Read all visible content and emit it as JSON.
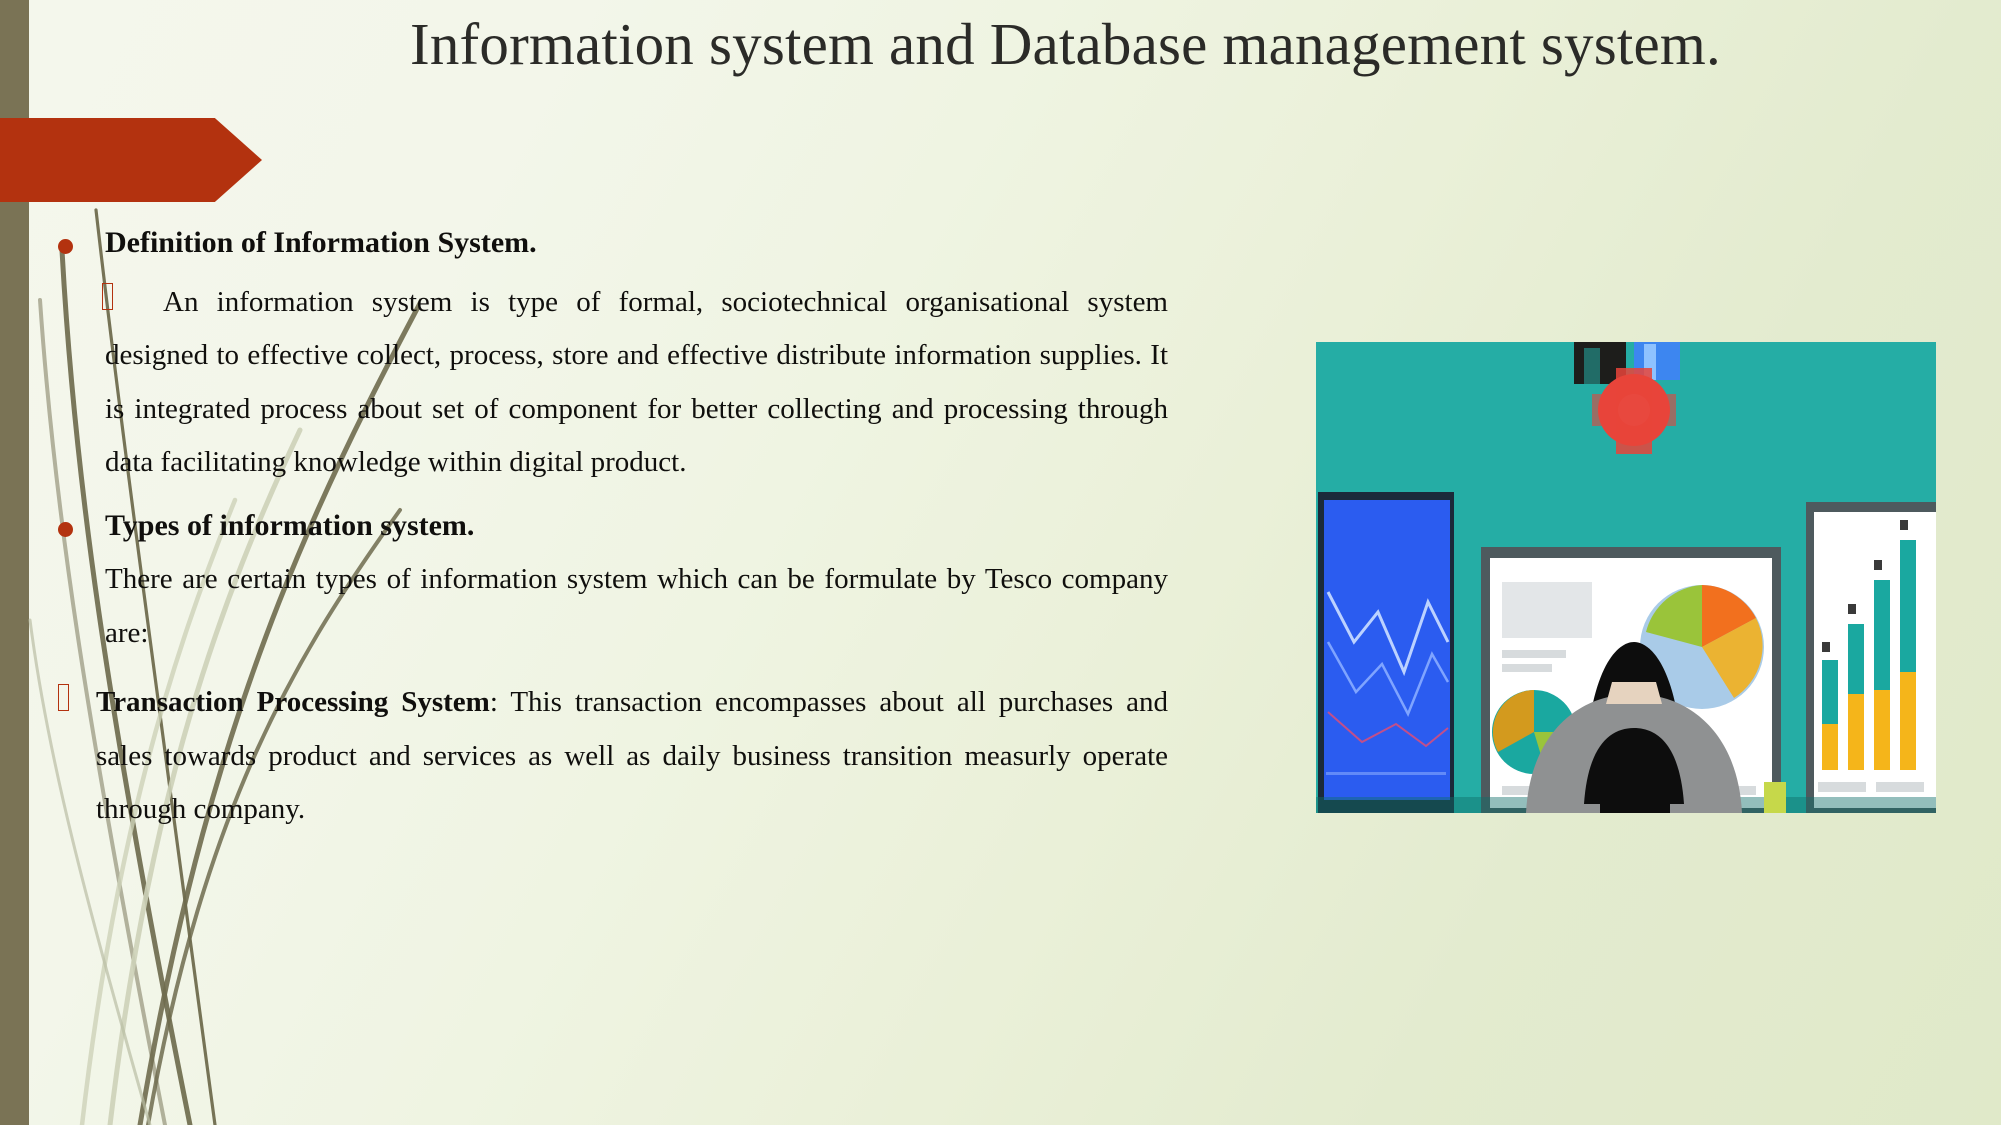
{
  "slide": {
    "title": "Information system and Database management system.",
    "background_color": "#eaf0da",
    "accent_color": "#b3320f",
    "left_bar_color": "#7a7355"
  },
  "content": {
    "heading1": "Definition of Information System.",
    "para1": "An information system is type of formal, sociotechnical organisational system designed to effective collect, process, store and effective distribute information supplies. It is integrated process about set of component for better collecting and processing through data facilitating knowledge within digital product.",
    "heading2": "Types of information system.",
    "para2": "There are certain types of information system which can be formulate by Tesco company are:",
    "item1_label": "Transaction Processing System",
    "item1_text": ": This transaction encompasses about all purchases and sales towards product and services as well as daily business transition measurly  operate through company."
  },
  "illustration": {
    "alt": "business-analyst-viewing-dashboards",
    "wall_color": "#25ada5",
    "left_monitor_color": "#2b5cf0",
    "bar_chart_teal": "#1aa8a0",
    "bar_chart_yellow": "#f5b51a",
    "pie_orange": "#f2701e",
    "pie_green": "#9ac43a",
    "pie_blue": "#a9cbe8",
    "gear_red": "#e8443a",
    "gear_blue": "#3d86f0",
    "person_shirt": "#8f9192",
    "person_hair": "#0d0d0d"
  }
}
